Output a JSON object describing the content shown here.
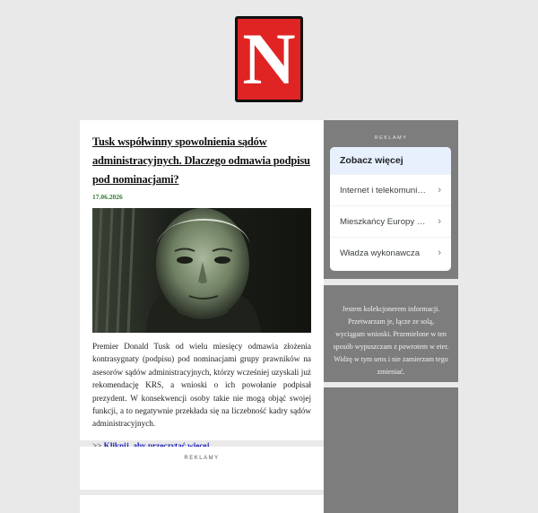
{
  "logo": {
    "letter": "N",
    "colors": {
      "background": "#e02424",
      "border": "#111111",
      "letter": "#ffffff"
    }
  },
  "post": {
    "title": "Tusk współwinny spowolnienia sądów administracyjnych. Dlaczego odmawia podpisu pod nominacjami?",
    "date": "17.06.2026",
    "image_alt_icon": "portrait-illustration",
    "body": "Premier Donald Tusk od wielu miesięcy odmawia złożenia kontrasygnaty (podpisu) pod nominacjami grupy prawników na asesorów sądów administracyjnych, którzy wcześniej uzyskali już rekomendację KRS, a wnioski o ich powołanie podpisał prezydent. W konsekwencji osoby takie nie mogą objąć swojej funkcji, a to negatywnie przekłada się na liczebność kadry sądów administracyjnych.",
    "read_more_prefix": ">> ",
    "read_more_link": "Kliknij, aby przeczytać więcej ..."
  },
  "ads_section": {
    "label": "REKLAMY"
  },
  "sidebar": {
    "ads_label": "REKLAMY",
    "widget": {
      "heading": "Zobacz więcej",
      "items": [
        {
          "label": "Internet i telekomunikacja"
        },
        {
          "label": "Mieszkańcy Europy Wschodniej"
        },
        {
          "label": "Władza wykonawcza"
        }
      ]
    },
    "note": "Jestem kolekcjonerem informacji. Przetwarzam je, łącze ze solą, wyciągam wnioski. Przemielone w ten sposób wypuszczam z powrotem w eter. Widzę w tym sens i nie zamierzam tego zmieniać."
  },
  "colors": {
    "page_bg": "#e9e9e9",
    "sidebar_bg": "#7d7d7d",
    "date": "#2c7a2c",
    "link": "#1a1ab8"
  }
}
